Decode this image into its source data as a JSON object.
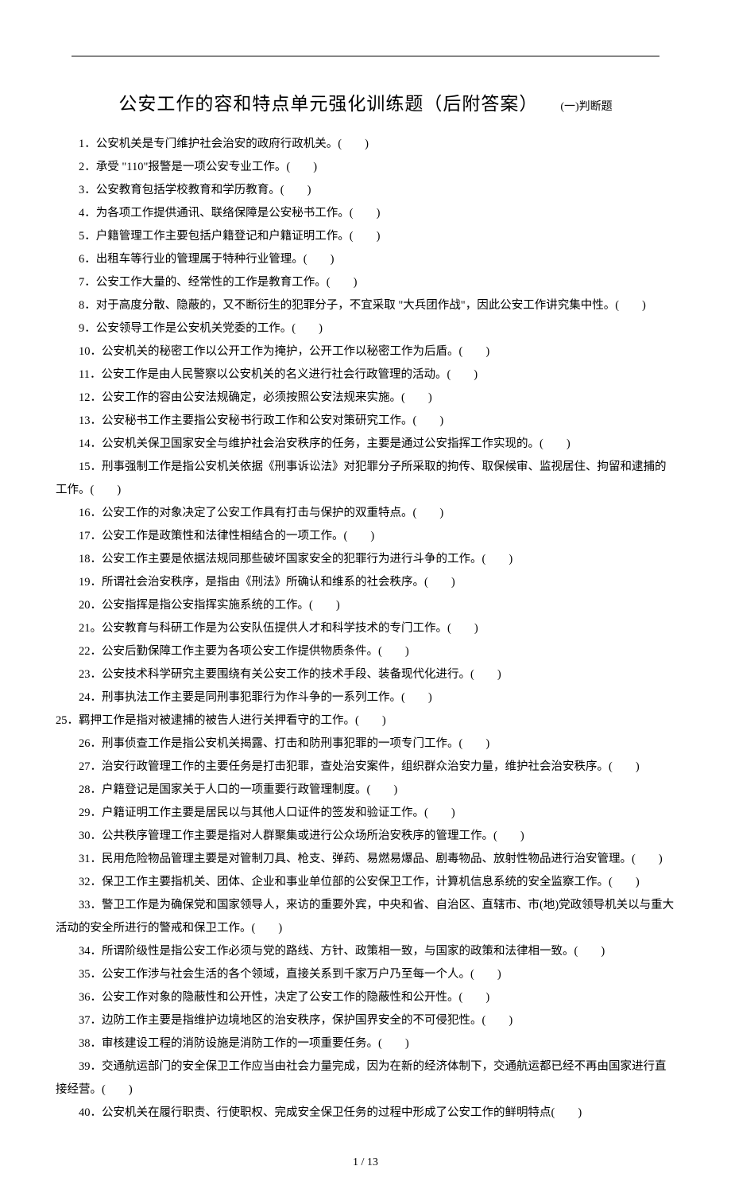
{
  "title_main": "公安工作的容和特点单元强化训练题（后附答案）",
  "title_sub": "(一)判断题",
  "questions": [
    "1．公安机关是专门维护社会治安的政府行政机关。(　　)",
    "2．承受 \"110\"报警是一项公安专业工作。(　　)",
    "3．公安教育包括学校教育和学历教育。(　　)",
    "4．为各项工作提供通讯、联络保障是公安秘书工作。(　　)",
    "5．户籍管理工作主要包括户籍登记和户籍证明工作。(　　)",
    "6．出租车等行业的管理属于特种行业管理。(　　)",
    "7．公安工作大量的、经常性的工作是教育工作。(　　)",
    "8．对于高度分散、隐蔽的，又不断衍生的犯罪分子，不宜采取 \"大兵团作战\"，因此公安工作讲究集中性。(　　)",
    "9．公安领导工作是公安机关党委的工作。(　　)",
    "10．公安机关的秘密工作以公开工作为掩护，公开工作以秘密工作为后盾。(　　)",
    "11．公安工作是由人民警察以公安机关的名义进行社会行政管理的活动。(　　)",
    "12．公安工作的容由公安法规确定，必须按照公安法规来实施。(　　)",
    "13．公安秘书工作主要指公安秘书行政工作和公安对策研究工作。(　　)",
    "14．公安机关保卫国家安全与维护社会治安秩序的任务，主要是通过公安指挥工作实现的。(　　)",
    "15．刑事强制工作是指公安机关依据《刑事诉讼法》对犯罪分子所采取的拘传、取保候审、监视居住、拘留和逮捕的工作。(　　)",
    "16．公安工作的对象决定了公安工作具有打击与保护的双重特点。(　　)",
    "17．公安工作是政策性和法律性相结合的一项工作。(　　)",
    "18．公安工作主要是依据法规同那些破坏国家安全的犯罪行为进行斗争的工作。(　　)",
    "19．所谓社会治安秩序，是指由《刑法》所确认和维系的社会秩序。(　　)",
    "20．公安指挥是指公安指挥实施系统的工作。(　　)",
    "21。公安教育与科研工作是为公安队伍提供人才和科学技术的专门工作。(　　)",
    "22．公安后勤保障工作主要为各项公安工作提供物质条件。(　　)",
    "23．公安技术科学研究主要围绕有关公安工作的技术手段、装备现代化进行。(　　)",
    "24．刑事执法工作主要是同刑事犯罪行为作斗争的一系列工作。(　　)"
  ],
  "q25": "25．羁押工作是指对被逮捕的被告人进行关押看守的工作。(　　)",
  "questions2": [
    "26．刑事侦查工作是指公安机关揭露、打击和防刑事犯罪的一项专门工作。(　　)",
    "27．治安行政管理工作的主要任务是打击犯罪，查处治安案件，组织群众治安力量，维护社会治安秩序。(　　)",
    "28．户籍登记是国家关于人口的一项重要行政管理制度。(　　)",
    "29．户籍证明工作主要是居民以与其他人口证件的签发和验证工作。(　　)",
    "30．公共秩序管理工作主要是指对人群聚集或进行公众场所治安秩序的管理工作。(　　)",
    "31．民用危险物品管理主要是对管制刀具、枪支、弹药、易燃易爆品、剧毒物品、放射性物品进行治安管理。(　　)",
    "32．保卫工作主要指机关、团体、企业和事业单位部的公安保卫工作，计算机信息系统的安全监察工作。(　　)",
    "33．警卫工作是为确保党和国家领导人，来访的重要外宾，中央和省、自治区、直辖市、市(地)党政领导机关以与重大活动的安全所进行的警戒和保卫工作。(　　)",
    "34．所谓阶级性是指公安工作必须与党的路线、方针、政策相一致，与国家的政策和法律相一致。(　　)",
    "35．公安工作涉与社会生活的各个领域，直接关系到千家万户乃至每一个人。(　　)",
    "36．公安工作对象的隐蔽性和公开性，决定了公安工作的隐蔽性和公开性。(　　)",
    "37．边防工作主要是指维护边境地区的治安秩序，保护国界安全的不可侵犯性。(　　)",
    "38．审核建设工程的消防设施是消防工作的一项重要任务。(　　)",
    "39．交通航运部门的安全保卫工作应当由社会力量完成，因为在新的经济体制下，交通航运都已经不再由国家进行直接经营。(　　)",
    "40．公安机关在履行职责、行使职权、完成安全保卫任务的过程中形成了公安工作的鲜明特点(　　)"
  ],
  "footer": "1 / 13"
}
